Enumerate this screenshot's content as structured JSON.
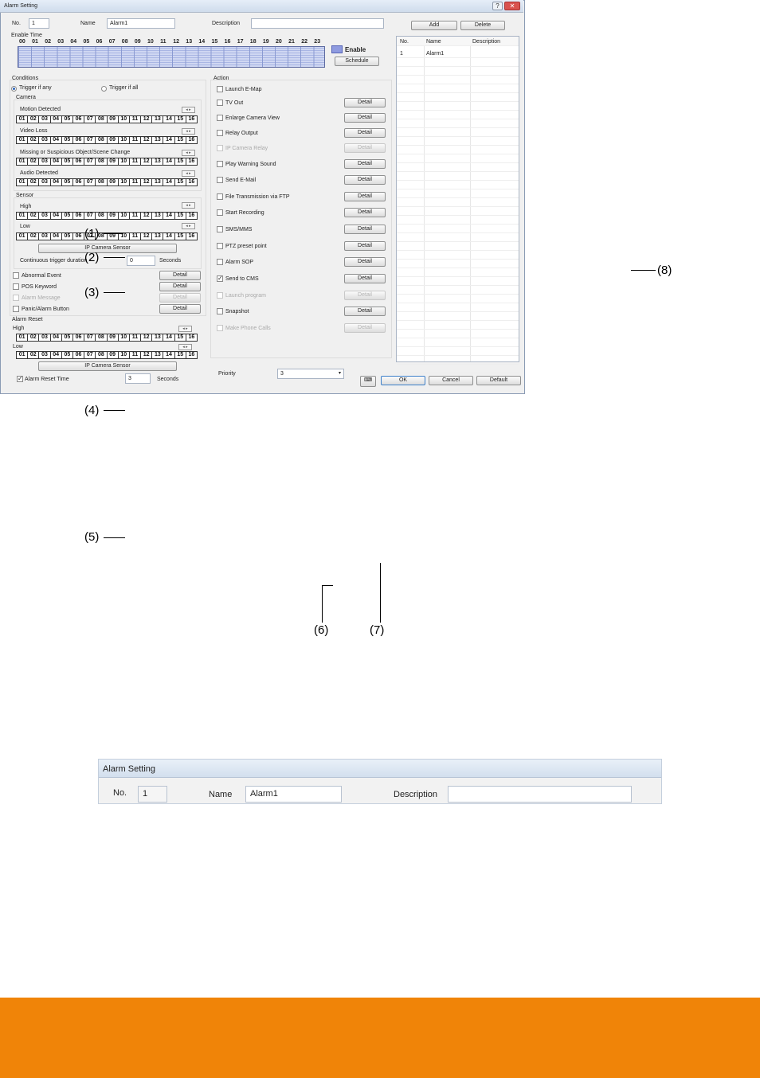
{
  "annotations": [
    "(1)",
    "(2)",
    "(3)",
    "(4)",
    "(5)",
    "(6)",
    "(7)",
    "(8)"
  ],
  "dialog": {
    "title": "Alarm Setting",
    "title_buttons": [
      "?",
      "✕"
    ],
    "no_label": "No.",
    "no_value": "1",
    "name_label": "Name",
    "name_value": "Alarm1",
    "description_label": "Description",
    "description_value": "",
    "add_button": "Add",
    "delete_button": "Delete",
    "enable_time_label": "Enable Time",
    "hours": [
      "00",
      "01",
      "02",
      "03",
      "04",
      "05",
      "06",
      "07",
      "08",
      "09",
      "10",
      "11",
      "12",
      "13",
      "14",
      "15",
      "16",
      "17",
      "18",
      "19",
      "20",
      "21",
      "22",
      "23"
    ],
    "enable_label": "Enable",
    "schedule_button": "Schedule",
    "conditions": {
      "label": "Conditions",
      "trigger_any": "Trigger if any",
      "trigger_all": "Trigger if all",
      "camera_label": "Camera",
      "motion_label": "Motion Detected",
      "video_loss_label": "Video Loss",
      "missing_label": "Missing or Suspicious Object/Scene Change",
      "audio_label": "Audio Detected",
      "sensor_label": "Sensor",
      "high_label": "High",
      "low_label": "Low",
      "ip_sensor_button": "IP Camera Sensor",
      "continuous_label": "Continuous trigger duration",
      "continuous_value": "0",
      "seconds_label": "Seconds",
      "abnormal_label": "Abnormal Event",
      "pos_label": "POS Keyword",
      "alarm_msg_label": "Alarm Message",
      "panic_label": "Panic/Alarm Button",
      "detail": "Detail",
      "channels": [
        "01",
        "02",
        "03",
        "04",
        "05",
        "06",
        "07",
        "08",
        "09",
        "10",
        "11",
        "12",
        "13",
        "14",
        "15",
        "16"
      ]
    },
    "alarm_reset": {
      "label": "Alarm Reset",
      "high_label": "High",
      "low_label": "Low",
      "ip_sensor_button": "IP Camera Sensor",
      "reset_time_label": "Alarm Reset Time",
      "reset_time_value": "3",
      "seconds_label": "Seconds"
    },
    "action": {
      "label": "Action",
      "items": [
        {
          "label": "Launch E-Map",
          "detail": false,
          "checked": false,
          "disabled": false
        },
        {
          "label": "TV Out",
          "detail": true,
          "checked": false,
          "disabled": false
        },
        {
          "label": "Enlarge Camera View",
          "detail": true,
          "checked": false,
          "disabled": false
        },
        {
          "label": "Relay Output",
          "detail": true,
          "checked": false,
          "disabled": false
        },
        {
          "label": "IP Camera Relay",
          "detail": true,
          "checked": false,
          "disabled": true
        },
        {
          "label": "Play Warning Sound",
          "detail": true,
          "checked": false,
          "disabled": false
        },
        {
          "label": "Send E-Mail",
          "detail": true,
          "checked": false,
          "disabled": false
        },
        {
          "label": "File Transmission via FTP",
          "detail": true,
          "checked": false,
          "disabled": false
        },
        {
          "label": "Start Recording",
          "detail": true,
          "checked": false,
          "disabled": false
        },
        {
          "label": "SMS/MMS",
          "detail": true,
          "checked": false,
          "disabled": false
        },
        {
          "label": "PTZ preset point",
          "detail": true,
          "checked": false,
          "disabled": false
        },
        {
          "label": "Alarm SOP",
          "detail": true,
          "checked": false,
          "disabled": false
        },
        {
          "label": "Send to CMS",
          "detail": true,
          "checked": true,
          "disabled": false
        },
        {
          "label": "Launch program",
          "detail": true,
          "checked": false,
          "disabled": true
        },
        {
          "label": "Snapshot",
          "detail": true,
          "checked": false,
          "disabled": false
        },
        {
          "label": "Make Phone Calls",
          "detail": true,
          "checked": false,
          "disabled": true
        }
      ]
    },
    "priority_label": "Priority",
    "priority_value": "3",
    "ok_button": "OK",
    "cancel_button": "Cancel",
    "default_button": "Default",
    "list": {
      "headers": [
        "No.",
        "Name",
        "Description"
      ],
      "rows": [
        [
          "1",
          "Alarm1",
          ""
        ]
      ]
    }
  },
  "strip": {
    "title": "Alarm Setting",
    "no_label": "No.",
    "no_value": "1",
    "name_label": "Name",
    "name_value": "Alarm1",
    "description_label": "Description",
    "description_value": ""
  },
  "colors": {
    "footer": "#f08408",
    "accent": "#2a62b8"
  }
}
